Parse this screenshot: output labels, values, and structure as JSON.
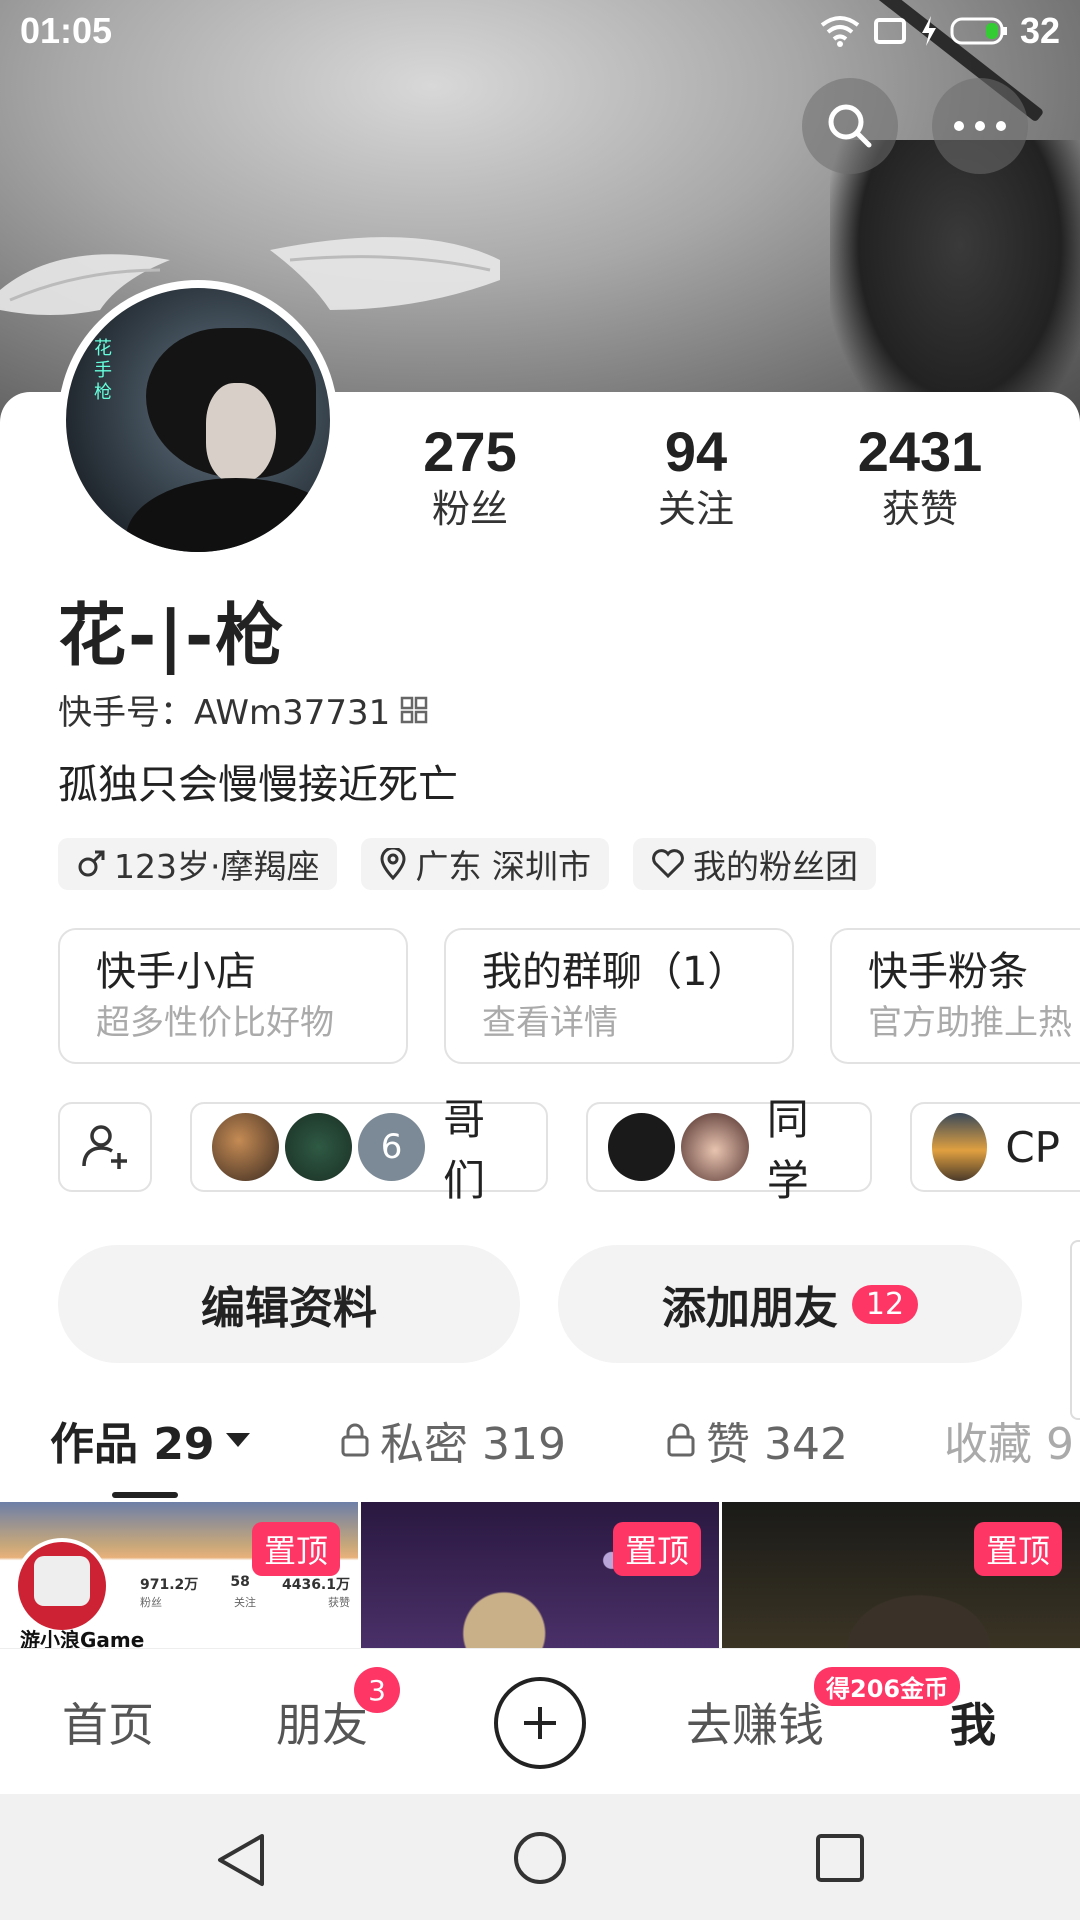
{
  "status_bar": {
    "time": "01:05",
    "battery": "32"
  },
  "profile": {
    "avatar_text": "花手枪",
    "name": "花-|-枪",
    "kuaishou_id": "快手号：AWm37731",
    "bio": "孤独只会慢慢接近死亡",
    "stats": [
      {
        "value": "275",
        "label": "粉丝"
      },
      {
        "value": "94",
        "label": "关注"
      },
      {
        "value": "2431",
        "label": "获赞"
      }
    ],
    "tags": [
      "123岁·摩羯座",
      "广东 深圳市",
      "我的粉丝团"
    ]
  },
  "services": [
    {
      "title": "快手小店",
      "subtitle": "超多性价比好物"
    },
    {
      "title": "我的群聊（1）",
      "subtitle": "查看详情"
    },
    {
      "title": "快手粉条",
      "subtitle": "官方助推上热"
    }
  ],
  "groups": [
    {
      "name": "哥们",
      "more_count": "6"
    },
    {
      "name": "同学"
    },
    {
      "name": "CP"
    }
  ],
  "actions": {
    "edit_profile": "编辑资料",
    "add_friend": "添加朋友",
    "add_friend_badge": "12"
  },
  "tabs": [
    {
      "label": "作品 29"
    },
    {
      "label": "私密 319"
    },
    {
      "label": "赞 342"
    },
    {
      "label": "收藏 9"
    }
  ],
  "thumbnails": [
    {
      "pin": "置顶",
      "caption": "游小浪Game",
      "stats": [
        "971.2万",
        "58",
        "4436.1万"
      ],
      "stat_labels": [
        "粉丝",
        "关注",
        "获赞"
      ]
    },
    {
      "pin": "置顶"
    },
    {
      "pin": "置顶"
    }
  ],
  "bottom_nav": {
    "home": "首页",
    "friends": "朋友",
    "friends_badge": "3",
    "earn": "去赚钱",
    "earn_badge": "得206金币",
    "me": "我"
  },
  "colors": {
    "accent": "#fe3666"
  }
}
